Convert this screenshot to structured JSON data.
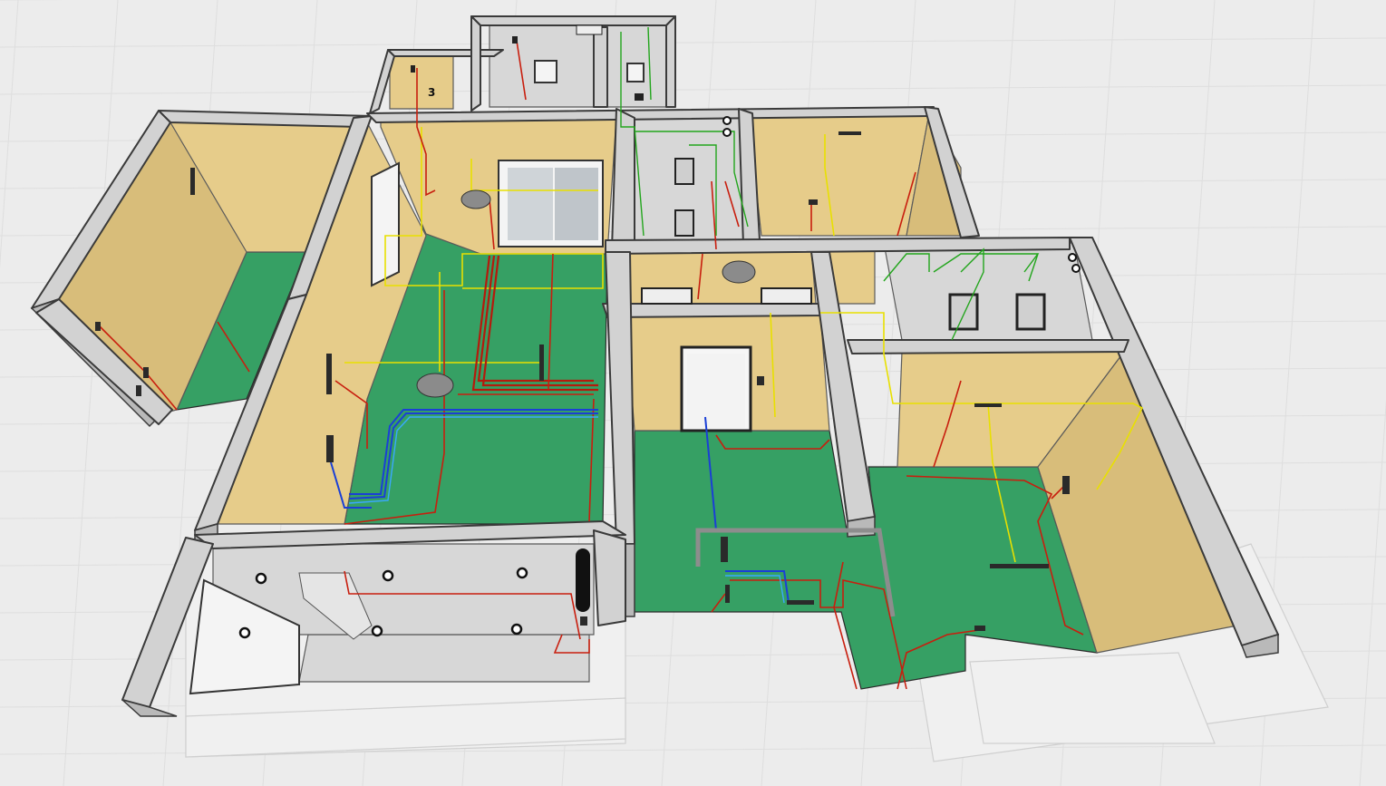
{
  "scene": {
    "background": "#ececec",
    "tile_line_color": "#dedede",
    "colors": {
      "wall": "#d2d2d2",
      "wall_outline": "#3a3a3a",
      "room_wall_yellow": "#e6cc8a",
      "room_wall_grey": "#d7d7d7",
      "floor_green": "#36a064",
      "pipe_red": "#c81e0e",
      "pipe_yellow": "#e8e000",
      "pipe_blue": "#1a3fd6",
      "pipe_light_blue": "#3aa8ff",
      "pipe_green": "#22a51c"
    }
  },
  "labels": {
    "fixture_marker": "3"
  },
  "icons": [
    "socket-icon",
    "ceiling-light-icon",
    "door-icon",
    "window-icon",
    "panel-icon"
  ]
}
